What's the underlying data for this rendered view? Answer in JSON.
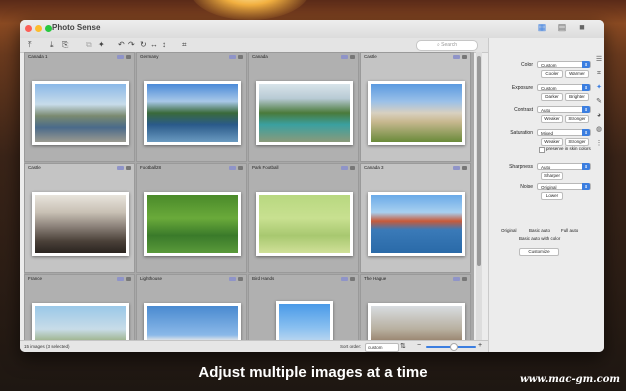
{
  "window": {
    "title": "Photo Sense"
  },
  "search": {
    "placeholder": "Search"
  },
  "grid": {
    "cells": [
      {
        "label": "Canada 1"
      },
      {
        "label": "Germany"
      },
      {
        "label": "Canada"
      },
      {
        "label": "Castle"
      },
      {
        "label": "Castle"
      },
      {
        "label": "Football28"
      },
      {
        "label": "Park Football"
      },
      {
        "label": "Canada 3"
      },
      {
        "label": "France"
      },
      {
        "label": "Lighthouse"
      },
      {
        "label": "Bird Hands"
      },
      {
        "label": "The Hague"
      }
    ]
  },
  "status": {
    "count": "15 images (3 selected)",
    "sort_label": "Sort order:",
    "sort_value": "custom"
  },
  "panel": {
    "color": {
      "label": "Color",
      "value": "Custom",
      "buttons": [
        "Cooler",
        "Warmer"
      ]
    },
    "exposure": {
      "label": "Exposure",
      "value": "Custom",
      "buttons": [
        "Darker",
        "Brighter"
      ]
    },
    "contrast": {
      "label": "Contrast",
      "value": "Auto",
      "buttons": [
        "Weaker",
        "Stronger"
      ]
    },
    "saturation": {
      "label": "Saturation",
      "value": "Mixed",
      "buttons": [
        "Weaker",
        "Stronger"
      ],
      "checkbox": "preserve in skin colors"
    },
    "sharpness": {
      "label": "Sharpness",
      "value": "Auto",
      "buttons": [
        "Sharper"
      ]
    },
    "noise": {
      "label": "Noise",
      "value": "Original",
      "buttons": [
        "Lower"
      ]
    },
    "modes": [
      "Original",
      "Basic auto",
      "Full auto"
    ],
    "mode_sub": "Basic auto with color",
    "customize": "Customize"
  },
  "caption": "Adjust multiple images at a time",
  "watermark": "www.mac-gm.com"
}
